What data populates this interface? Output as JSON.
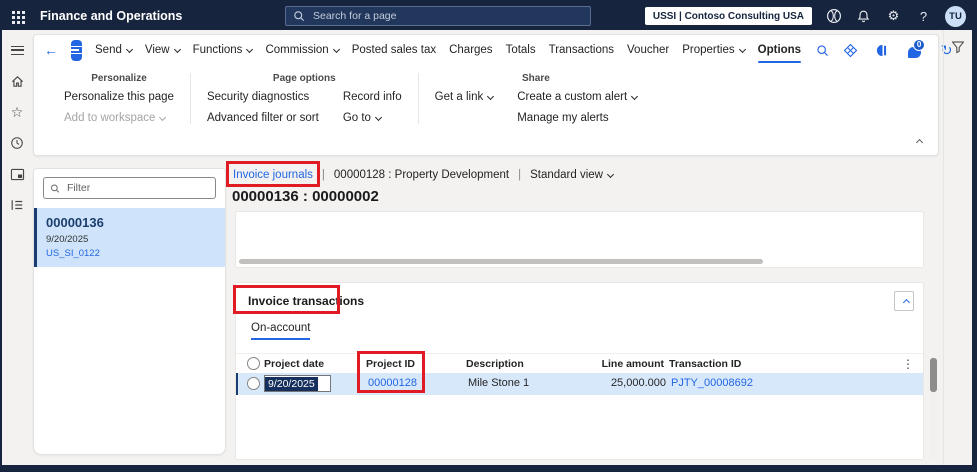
{
  "topbar": {
    "app_title": "Finance and Operations",
    "search_placeholder": "Search for a page",
    "environment_label": "USSI | Contoso Consulting USA",
    "help_glyph": "?",
    "avatar_initials": "TU"
  },
  "action_pane": {
    "back_glyph": "←",
    "menu": [
      {
        "label": "Send",
        "chevron": true
      },
      {
        "label": "View",
        "chevron": true
      },
      {
        "label": "Functions",
        "chevron": true
      },
      {
        "label": "Commission",
        "chevron": true
      },
      {
        "label": "Posted sales tax"
      },
      {
        "label": "Charges"
      },
      {
        "label": "Totals"
      },
      {
        "label": "Transactions"
      },
      {
        "label": "Voucher"
      },
      {
        "label": "Properties",
        "chevron": true
      },
      {
        "label": "Options",
        "selected": true
      }
    ],
    "ribbon": [
      {
        "title": "Personalize",
        "columns": [
          [
            {
              "label": "Personalize this page"
            },
            {
              "label": "Add to workspace",
              "chevron": true,
              "disabled": true
            }
          ]
        ]
      },
      {
        "title": "Page options",
        "columns": [
          [
            {
              "label": "Security diagnostics"
            },
            {
              "label": "Advanced filter or sort"
            }
          ],
          [
            {
              "label": "Record info"
            },
            {
              "label": "Go to",
              "chevron": true
            }
          ]
        ]
      },
      {
        "title": "Share",
        "columns": [
          [
            {
              "label": "Get a link",
              "chevron": true
            }
          ],
          [
            {
              "label": "Create a custom alert",
              "chevron": true
            },
            {
              "label": "Manage my alerts"
            }
          ]
        ]
      }
    ],
    "badge_count": "0",
    "refresh_glyph": "↻"
  },
  "left_panel": {
    "filter_placeholder": "Filter",
    "items": [
      {
        "id": "00000136",
        "date": "9/20/2025",
        "code": "US_SI_0122",
        "selected": true
      }
    ]
  },
  "breadcrumb": {
    "journal_link": "Invoice journals",
    "separator": "|",
    "record": "00000128 : Property Development",
    "view_label": "Standard view"
  },
  "page_title": "00000136 : 00000002",
  "transactions": {
    "section_title": "Invoice transactions",
    "tab_label": "On-account",
    "columns": [
      "Project date",
      "Project ID",
      "Description",
      "Line amount",
      "Transaction ID"
    ],
    "more_glyph": "⋮",
    "rows": [
      {
        "project_date": "9/20/2025",
        "project_id": "00000128",
        "description": "Mile Stone 1",
        "line_amount": "25,000.000",
        "transaction_id": "PJTY_00008692"
      }
    ]
  },
  "rail_icons": [
    "menu",
    "home",
    "favorites",
    "recent",
    "workspaces",
    "modules"
  ],
  "colors": {
    "accent": "#2266E3",
    "topbar": "#16243E",
    "selection": "#16305E",
    "row_selected": "#D8E8FB",
    "annotation": "#E01B24"
  }
}
